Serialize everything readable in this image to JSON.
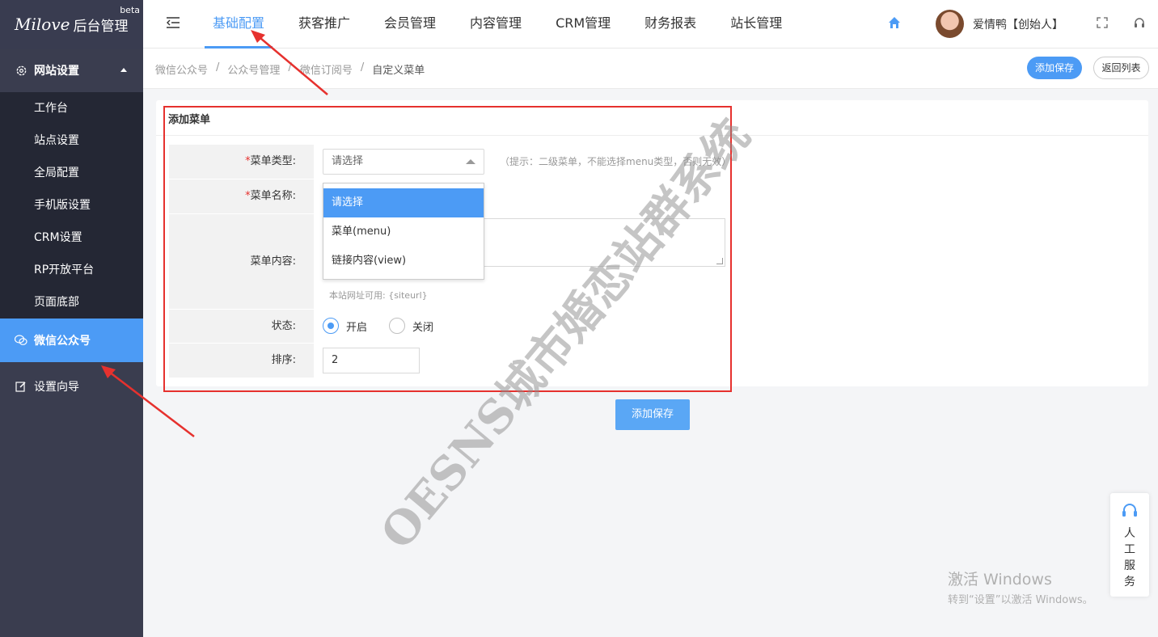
{
  "sidebar": {
    "logo_script": "Milove",
    "logo_text": "后台管理",
    "beta": "beta",
    "group": "网站设置",
    "items": [
      "工作台",
      "站点设置",
      "全局配置",
      "手机版设置",
      "CRM设置",
      "RP开放平台",
      "页面底部"
    ],
    "active": "微信公众号",
    "wizard": "设置向导"
  },
  "topbar": {
    "tabs": [
      "基础配置",
      "获客推广",
      "会员管理",
      "内容管理",
      "CRM管理",
      "财务报表",
      "站长管理"
    ],
    "user": "爱情鸭【创始人】"
  },
  "breadcrumb": [
    "微信公众号",
    "公众号管理",
    "微信订阅号",
    "自定义菜单"
  ],
  "buttons": {
    "save_top": "添加保存",
    "back": "返回列表",
    "save_bottom": "添加保存"
  },
  "form": {
    "title": "添加菜单",
    "req_mark": "*",
    "type_label": "菜单类型:",
    "type_value": "请选择",
    "type_hint": "（提示：二级菜单，不能选择menu类型，否则无效）",
    "name_label": "菜单名称:",
    "content_label": "菜单内容:",
    "content_hint": "本站网址可用: {siteurl}",
    "status_label": "状态:",
    "status_on": "开启",
    "status_off": "关闭",
    "sort_label": "排序:",
    "sort_value": "2"
  },
  "dropdown": [
    "请选择",
    "菜单(menu)",
    "链接内容(view)"
  ],
  "watermark": "OESNS城市婚恋站群系统",
  "windows": {
    "line1": "激活 Windows",
    "line2": "转到“设置”以激活 Windows。"
  },
  "service": "人工服务",
  "colors": {
    "accent": "#4c9bf5",
    "sidebar": "#3a3d4f",
    "highlight": "#e6312e"
  }
}
